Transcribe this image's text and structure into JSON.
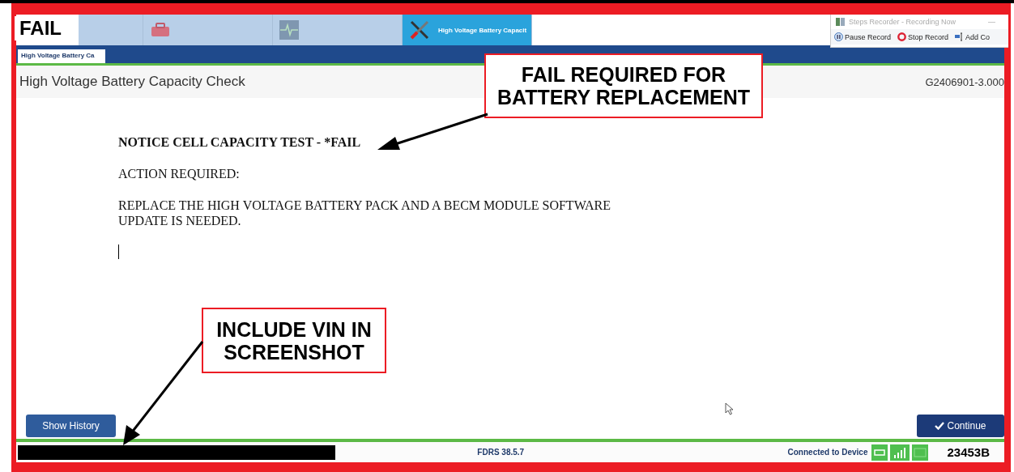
{
  "stamp": "FAIL",
  "app_tabs": [
    {
      "kind": "plain",
      "selected": false
    },
    {
      "kind": "toolbox",
      "selected": false
    },
    {
      "kind": "monitor",
      "selected": false
    },
    {
      "kind": "tools",
      "selected": true,
      "label": "High Voltage Battery Capacit"
    }
  ],
  "recorder": {
    "title": "Steps Recorder - Recording Now",
    "minimize": "—",
    "buttons": [
      {
        "kind": "pause",
        "label": "Pause Record"
      },
      {
        "kind": "stop",
        "label": "Stop Record"
      },
      {
        "kind": "add",
        "label": "Add Co"
      }
    ]
  },
  "subtab": {
    "label": "High Voltage Battery Ca",
    "selected": true
  },
  "header": {
    "title": "High Voltage Battery Capacity Check",
    "code": "G2406901-3.000"
  },
  "message": [
    {
      "kind": "heading",
      "text": "NOTICE CELL CAPACITY TEST - *FAIL"
    },
    {
      "kind": "body",
      "text": "ACTION REQUIRED:"
    },
    {
      "kind": "body",
      "text": "REPLACE THE HIGH VOLTAGE BATTERY PACK AND A BECM MODULE SOFTWARE UPDATE IS NEEDED."
    }
  ],
  "buttons": {
    "left": "Show History",
    "right": "Continue"
  },
  "status_bar": {
    "version": "FDRS 38.5.7",
    "connection": "Connected to Device",
    "vin": "23453B"
  },
  "callouts": [
    {
      "kind": "top",
      "text": "FAIL REQUIRED FOR BATTERY REPLACEMENT"
    },
    {
      "kind": "bottom",
      "text": "INCLUDE VIN IN SCREENSHOT"
    }
  ]
}
